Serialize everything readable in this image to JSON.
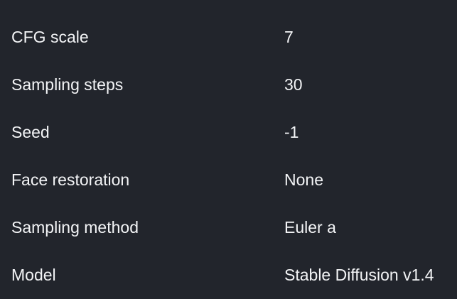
{
  "settings": {
    "rows": [
      {
        "label": "CFG scale",
        "value": "7"
      },
      {
        "label": "Sampling steps",
        "value": "30"
      },
      {
        "label": "Seed",
        "value": "-1"
      },
      {
        "label": "Face restoration",
        "value": "None"
      },
      {
        "label": "Sampling method",
        "value": "Euler a"
      },
      {
        "label": "Model",
        "value": "Stable Diffusion v1.4"
      }
    ]
  },
  "colors": {
    "background": "#22252c",
    "text": "#f3f4f6"
  }
}
